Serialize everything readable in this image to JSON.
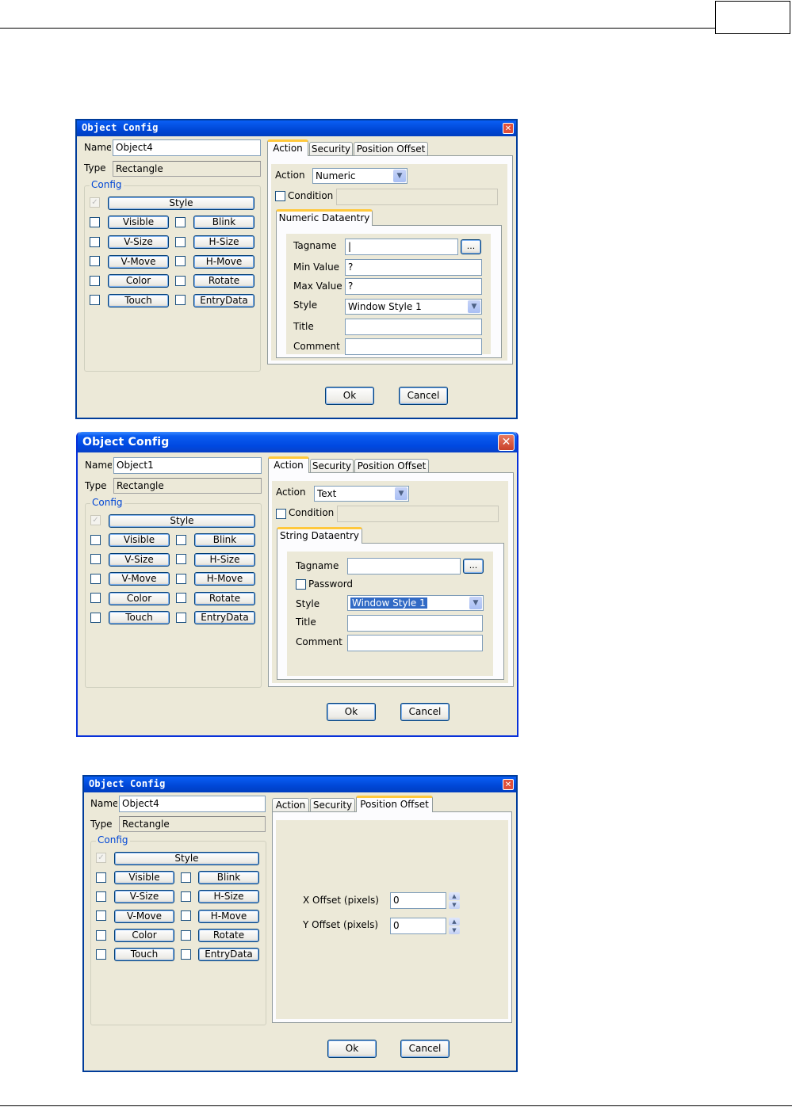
{
  "common": {
    "name_label": "Name",
    "type_label": "Type",
    "type_value": "Rectangle",
    "config_label": "Config",
    "style_button": "Style",
    "visible_button": "Visible",
    "blink_button": "Blink",
    "vsize_button": "V-Size",
    "hsize_button": "H-Size",
    "vmove_button": "V-Move",
    "hmove_button": "H-Move",
    "color_button": "Color",
    "rotate_button": "Rotate",
    "touch_button": "Touch",
    "entrydata_button": "EntryData",
    "tab_action": "Action",
    "tab_security": "Security",
    "tab_position_offset": "Position Offset",
    "action_label": "Action",
    "condition_label": "Condition",
    "tagname_label": "Tagname",
    "browse_button": "...",
    "style_label": "Style",
    "title_label": "Title",
    "comment_label": "Comment",
    "ok_button": "Ok",
    "cancel_button": "Cancel",
    "close_glyph": "✕",
    "check_glyph": "✓"
  },
  "dialog1": {
    "title": "Object Config",
    "name_value": "Object4",
    "action_value": "Numeric",
    "subtab": "Numeric Dataentry",
    "tagname_value": "|",
    "min_label": "Min Value",
    "min_value": "?",
    "max_label": "Max Value",
    "max_value": "?",
    "style_value": "Window Style 1"
  },
  "dialog2": {
    "title": "Object Config",
    "name_value": "Object1",
    "action_value": "Text",
    "subtab": "String Dataentry",
    "tagname_value": "",
    "password_label": "Password",
    "style_value": "Window Style 1"
  },
  "dialog3": {
    "title": "Object Config",
    "name_value": "Object4",
    "x_offset_label": "X Offset (pixels)",
    "x_offset_value": "0",
    "y_offset_label": "Y Offset (pixels)",
    "y_offset_value": "0"
  }
}
